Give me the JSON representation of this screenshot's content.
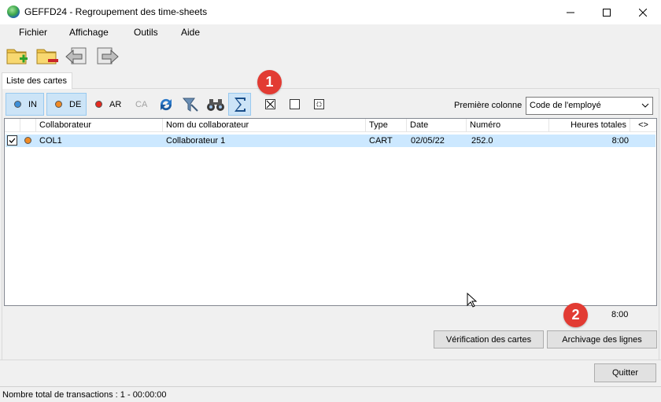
{
  "window": {
    "title": "GEFFD24 - Regroupement des time-sheets",
    "controls": {
      "minimize": "minimize-icon",
      "maximize": "maximize-icon",
      "close": "close-icon"
    }
  },
  "menu": [
    "Fichier",
    "Affichage",
    "Outils",
    "Aide"
  ],
  "toolbar": {
    "icons": [
      "folder-add-icon",
      "folder-remove-icon",
      "back-icon",
      "forward-icon"
    ]
  },
  "tabs": [
    {
      "label": "Liste des cartes",
      "active": true
    }
  ],
  "filters": {
    "in": {
      "label": "IN",
      "color": "#3d8fd8",
      "active": true
    },
    "de": {
      "label": "DE",
      "color": "#f08a24",
      "active": true
    },
    "ar": {
      "label": "AR",
      "color": "#e52a1f",
      "active": false
    },
    "ca": {
      "label": "CA",
      "active": false
    }
  },
  "tools": [
    "refresh-icon",
    "funnel-icon",
    "binoculars-icon",
    "sum-icon"
  ],
  "selection_icons": [
    "check-all-icon",
    "uncheck-all-icon",
    "invert-check-icon"
  ],
  "first_column": {
    "label": "Première colonne",
    "selected": "Code de l'employé"
  },
  "grid": {
    "headers": {
      "collaborateur": "Collaborateur",
      "nom": "Nom du collaborateur",
      "type": "Type",
      "date": "Date",
      "numero": "Numéro",
      "heures": "Heures totales",
      "nav": "<>"
    },
    "rows": [
      {
        "checked": true,
        "status_color": "#f08a24",
        "collaborateur": "COL1",
        "nom": "Collaborateur 1",
        "type": "CART",
        "date": "02/05/22",
        "numero": "252.0",
        "heures": "8:00"
      }
    ]
  },
  "total_hours": "8:00",
  "buttons": {
    "verif": "Vérification des cartes",
    "archive": "Archivage des lignes",
    "quit": "Quitter"
  },
  "status": "Nombre total de transactions : 1 - 00:00:00",
  "callouts": [
    "1",
    "2"
  ],
  "colors": {
    "selection": "#cce8ff",
    "active_toggle": "#cce4f7",
    "callout": "#e23b33"
  }
}
